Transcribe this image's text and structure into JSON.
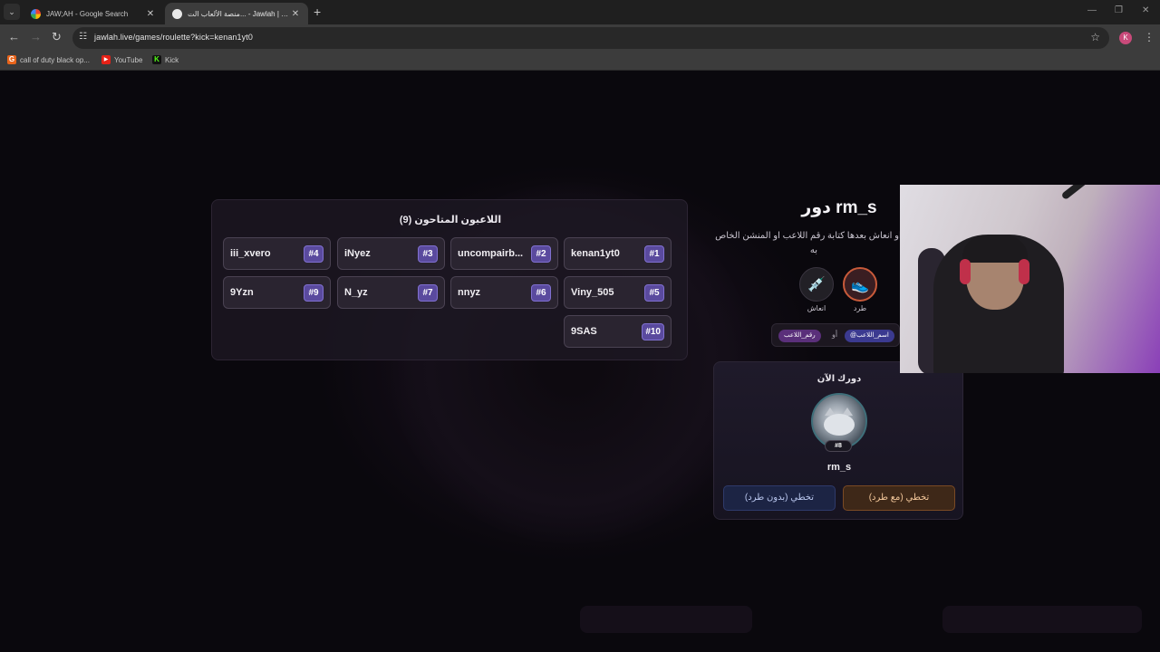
{
  "browser": {
    "tabs": [
      {
        "title": "JAW;AH - Google Search",
        "active": false
      },
      {
        "title": "منصة الألعاب الت... - Jawlah | جولة",
        "active": true
      }
    ],
    "url": "jawlah.live/games/roulette?kick=kenan1yt0",
    "profile_initial": "K",
    "bookmarks": [
      {
        "label": "call of duty black op...",
        "icon": "G"
      },
      {
        "label": "YouTube",
        "icon": "▶"
      },
      {
        "label": "Kick",
        "icon": "K"
      }
    ]
  },
  "players": {
    "title": "اللاعبون المتاحون (9)",
    "list": [
      {
        "name": "kenan1yt0",
        "num": "#1"
      },
      {
        "name": "uncompairb...",
        "num": "#2"
      },
      {
        "name": "iNyez",
        "num": "#3"
      },
      {
        "name": "iii_xvero",
        "num": "#4"
      },
      {
        "name": "Viny_505",
        "num": "#5"
      },
      {
        "name": "nnyz",
        "num": "#6"
      },
      {
        "name": "N_yz",
        "num": "#7"
      },
      {
        "name": "9Yzn",
        "num": "#9"
      },
      {
        "name": "9SAS",
        "num": "#10"
      }
    ]
  },
  "turn": {
    "title": "دور rm_s",
    "instruction": "رد او انعاش بعدها كتابة رقم اللاعب او المنشن الخاص به",
    "actions": {
      "kick_label": "طرد",
      "revive_label": "انعاش"
    },
    "hint": {
      "name_chip": "@اسم_اللاعب",
      "or": "أو",
      "num_chip": "رقم_اللاعب"
    }
  },
  "now": {
    "label": "دورك الآن",
    "player_name": "rm_s",
    "player_num": "#8",
    "skip_with_kick": "تخطي (مع طرد)",
    "skip_without_kick": "تخطي (بدون طرد)"
  },
  "colors": {
    "accent": "#5a4a9e",
    "kick": "#c85a3a",
    "page_bg": "#0a080d"
  }
}
